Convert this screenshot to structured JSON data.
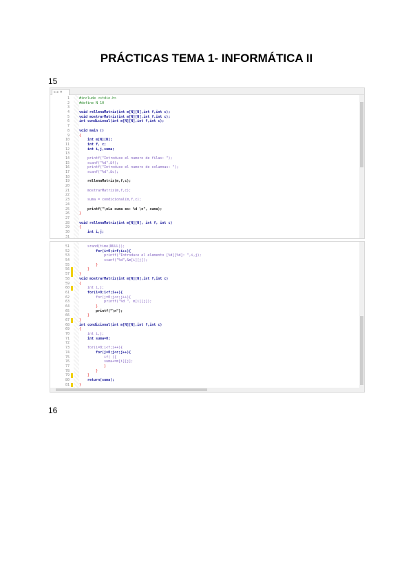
{
  "title": "PRÁCTICAS TEMA 1- INFORMÁTICA II",
  "sections": [
    {
      "number": "15"
    },
    {
      "number": "16"
    }
  ],
  "editor_tab": "c.c ✕",
  "panel1": [
    {
      "n": "1",
      "t": "#include <stdio.h>",
      "c": "pp"
    },
    {
      "n": "2",
      "t": "#define N 10",
      "c": "pp"
    },
    {
      "n": "3",
      "t": "",
      "c": ""
    },
    {
      "n": "4",
      "t": "void rellenaMatriz(int m[N][N],int f,int c);",
      "c": "kw"
    },
    {
      "n": "5",
      "t": "void mostrarMatriz(int m[N][N],int f,int c);",
      "c": "kw"
    },
    {
      "n": "6",
      "t": "int condicional(int m[N][N],int f,int c);",
      "c": "kw"
    },
    {
      "n": "7",
      "t": "",
      "c": ""
    },
    {
      "n": "8",
      "t": "void main ()",
      "c": "kw"
    },
    {
      "n": "9",
      "t": "{",
      "c": "br"
    },
    {
      "n": "10",
      "t": "    int m[N][N];",
      "c": "kw"
    },
    {
      "n": "11",
      "t": "    int f, c;",
      "c": "kw"
    },
    {
      "n": "12",
      "t": "    int i,j,suma;",
      "c": "kw"
    },
    {
      "n": "13",
      "t": "",
      "c": ""
    },
    {
      "n": "14",
      "t": "    printf(\"Introduce el numero de filas: \");",
      "c": "st"
    },
    {
      "n": "15",
      "t": "    scanf(\"%d\",&f);",
      "c": "st"
    },
    {
      "n": "16",
      "t": "    printf(\"Introduce el numero de columnas: \");",
      "c": "st"
    },
    {
      "n": "17",
      "t": "    scanf(\"%d\",&c);",
      "c": "st"
    },
    {
      "n": "18",
      "t": "",
      "c": ""
    },
    {
      "n": "19",
      "t": "    rellenaMatriz(m,f,c);",
      "c": "fn"
    },
    {
      "n": "20",
      "t": "",
      "c": ""
    },
    {
      "n": "21",
      "t": "    mostrarMatriz(m,f,c);",
      "c": "st"
    },
    {
      "n": "22",
      "t": "",
      "c": ""
    },
    {
      "n": "23",
      "t": "    suma = condicional(m,f,c);",
      "c": "st"
    },
    {
      "n": "24",
      "t": "",
      "c": ""
    },
    {
      "n": "25",
      "t": "    printf(\"\\nLa suma es: %d \\n\", suma);",
      "c": "fn"
    },
    {
      "n": "26",
      "t": "}",
      "c": "br"
    },
    {
      "n": "27",
      "t": "",
      "c": ""
    },
    {
      "n": "28",
      "t": "void rellenaMatriz(int m[N][N], int f, int c)",
      "c": "kw"
    },
    {
      "n": "29",
      "t": "{",
      "c": "br"
    },
    {
      "n": "30",
      "t": "    int i,j;",
      "c": "kw"
    },
    {
      "n": "31",
      "t": "",
      "c": ""
    }
  ],
  "panel2": [
    {
      "n": "51",
      "t": "    srand(time(NULL));",
      "c": "st"
    },
    {
      "n": "52",
      "t": "        for(i=0;i<f;i++){",
      "c": "kw"
    },
    {
      "n": "53",
      "t": "            printf(\"Introduce el elemento [%d][%d]: \",i,j);",
      "c": "st"
    },
    {
      "n": "54",
      "t": "            scanf(\"%d\",&m[i][j]);",
      "c": "st"
    },
    {
      "n": "55",
      "t": "        }",
      "c": "br"
    },
    {
      "n": "56",
      "t": "    }",
      "c": "br",
      "m": true
    },
    {
      "n": "57",
      "t": "}",
      "c": "br",
      "m": true
    },
    {
      "n": "58",
      "t": "void mostrarMatriz(int m[N][N],int f,int c)",
      "c": "kw"
    },
    {
      "n": "59",
      "t": "{",
      "c": "br"
    },
    {
      "n": "60",
      "t": "    int i,j;",
      "c": "st",
      "m": true
    },
    {
      "n": "61",
      "t": "    for(i=0;i<f;i++){",
      "c": "kw"
    },
    {
      "n": "62",
      "t": "        for(j=0;j<c;j++){",
      "c": "st"
    },
    {
      "n": "63",
      "t": "            printf(\"%d \", m[i][j]);",
      "c": "st"
    },
    {
      "n": "64",
      "t": "        }",
      "c": "br"
    },
    {
      "n": "65",
      "t": "        printf(\"\\n\");",
      "c": "fn"
    },
    {
      "n": "66",
      "t": "    }",
      "c": "br"
    },
    {
      "n": "67",
      "t": "}",
      "c": "br",
      "m": true
    },
    {
      "n": "68",
      "t": "int condicional(int m[N][N],int f,int c)",
      "c": "kw"
    },
    {
      "n": "69",
      "t": "{",
      "c": "br"
    },
    {
      "n": "70",
      "t": "    int i,j;",
      "c": "st"
    },
    {
      "n": "71",
      "t": "    int suma=0;",
      "c": "kw"
    },
    {
      "n": "72",
      "t": "",
      "c": ""
    },
    {
      "n": "73",
      "t": "    for(i=0;i<f;i++){",
      "c": "st"
    },
    {
      "n": "74",
      "t": "        for(j=0;j<c;j++){",
      "c": "kw"
    },
    {
      "n": "75",
      "t": "            if( ){",
      "c": "st"
    },
    {
      "n": "76",
      "t": "            suma+=m[i][j];",
      "c": "st"
    },
    {
      "n": "77",
      "t": "            }",
      "c": "br"
    },
    {
      "n": "78",
      "t": "        }",
      "c": "br"
    },
    {
      "n": "79",
      "t": "    }",
      "c": "br",
      "m": true
    },
    {
      "n": "80",
      "t": "    return(suma);",
      "c": "kw"
    },
    {
      "n": "81",
      "t": "}",
      "c": "br",
      "m": true
    }
  ]
}
